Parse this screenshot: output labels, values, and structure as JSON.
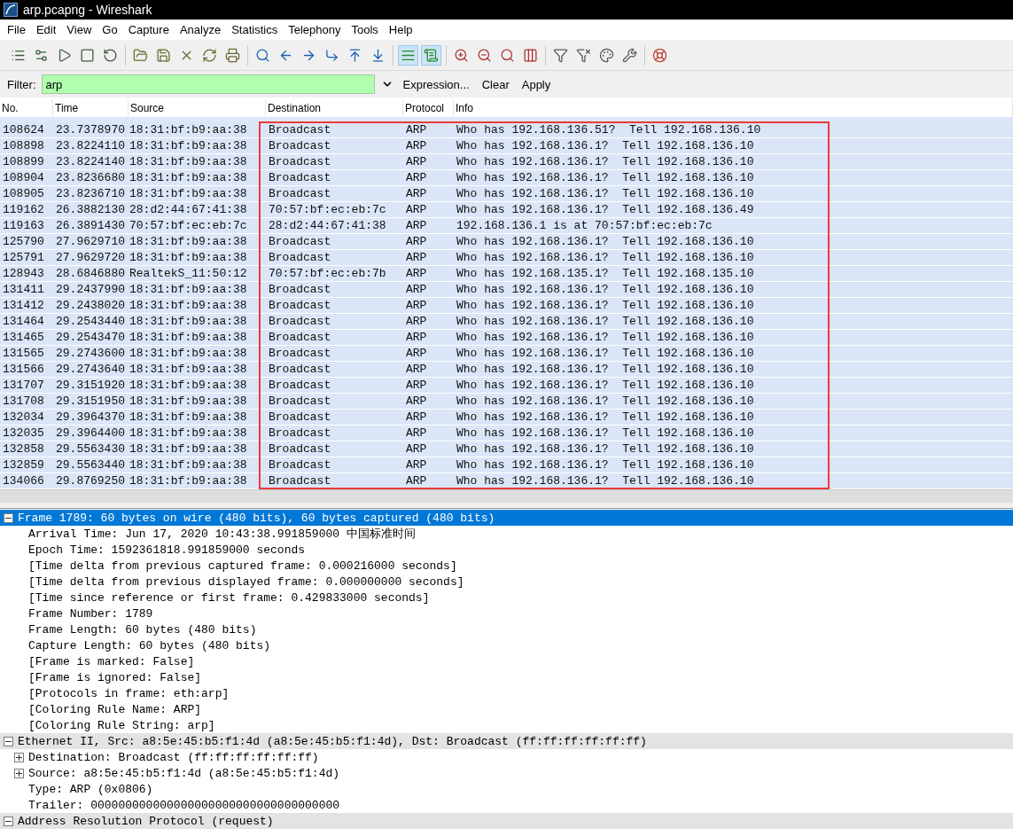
{
  "window": {
    "title": "arp.pcapng - Wireshark"
  },
  "menu": [
    "File",
    "Edit",
    "View",
    "Go",
    "Capture",
    "Analyze",
    "Statistics",
    "Telephony",
    "Tools",
    "Help"
  ],
  "toolbar": [
    [
      {
        "pressed": false
      },
      {
        "pressed": false
      },
      {
        "pressed": false
      },
      {
        "pressed": false
      },
      {
        "pressed": false
      }
    ],
    [
      {
        "pressed": false
      },
      {
        "pressed": false
      },
      {
        "pressed": false
      },
      {
        "pressed": false
      },
      {
        "pressed": false
      }
    ],
    [
      {
        "pressed": false
      },
      {
        "pressed": false
      },
      {
        "pressed": false
      },
      {
        "pressed": false
      },
      {
        "pressed": false
      },
      {
        "pressed": false
      }
    ],
    [
      {
        "pressed": true
      },
      {
        "pressed": true
      }
    ],
    [
      {
        "pressed": false
      },
      {
        "pressed": false
      },
      {
        "pressed": false
      },
      {
        "pressed": false
      }
    ],
    [
      {
        "pressed": false
      },
      {
        "pressed": false
      },
      {
        "pressed": false
      },
      {
        "pressed": false
      }
    ],
    [
      {
        "pressed": false
      }
    ]
  ],
  "filter": {
    "label": "Filter:",
    "value": "arp",
    "buttons": [
      "Expression...",
      "Clear",
      "Apply"
    ]
  },
  "packet_list": {
    "columns": [
      "No.",
      "Time",
      "Source",
      "Destination",
      "Protocol",
      "Info"
    ],
    "rows": [
      [
        "108624",
        "23.7378970",
        "18:31:bf:b9:aa:38",
        "Broadcast",
        "ARP",
        "Who has 192.168.136.51?  Tell 192.168.136.10"
      ],
      [
        "108898",
        "23.8224110",
        "18:31:bf:b9:aa:38",
        "Broadcast",
        "ARP",
        "Who has 192.168.136.1?  Tell 192.168.136.10"
      ],
      [
        "108899",
        "23.8224140",
        "18:31:bf:b9:aa:38",
        "Broadcast",
        "ARP",
        "Who has 192.168.136.1?  Tell 192.168.136.10"
      ],
      [
        "108904",
        "23.8236680",
        "18:31:bf:b9:aa:38",
        "Broadcast",
        "ARP",
        "Who has 192.168.136.1?  Tell 192.168.136.10"
      ],
      [
        "108905",
        "23.8236710",
        "18:31:bf:b9:aa:38",
        "Broadcast",
        "ARP",
        "Who has 192.168.136.1?  Tell 192.168.136.10"
      ],
      [
        "119162",
        "26.3882130",
        "28:d2:44:67:41:38",
        "70:57:bf:ec:eb:7c",
        "ARP",
        "Who has 192.168.136.1?  Tell 192.168.136.49"
      ],
      [
        "119163",
        "26.3891430",
        "70:57:bf:ec:eb:7c",
        "28:d2:44:67:41:38",
        "ARP",
        "192.168.136.1 is at 70:57:bf:ec:eb:7c"
      ],
      [
        "125790",
        "27.9629710",
        "18:31:bf:b9:aa:38",
        "Broadcast",
        "ARP",
        "Who has 192.168.136.1?  Tell 192.168.136.10"
      ],
      [
        "125791",
        "27.9629720",
        "18:31:bf:b9:aa:38",
        "Broadcast",
        "ARP",
        "Who has 192.168.136.1?  Tell 192.168.136.10"
      ],
      [
        "128943",
        "28.6846880",
        "RealtekS_11:50:12",
        "70:57:bf:ec:eb:7b",
        "ARP",
        "Who has 192.168.135.1?  Tell 192.168.135.10"
      ],
      [
        "131411",
        "29.2437990",
        "18:31:bf:b9:aa:38",
        "Broadcast",
        "ARP",
        "Who has 192.168.136.1?  Tell 192.168.136.10"
      ],
      [
        "131412",
        "29.2438020",
        "18:31:bf:b9:aa:38",
        "Broadcast",
        "ARP",
        "Who has 192.168.136.1?  Tell 192.168.136.10"
      ],
      [
        "131464",
        "29.2543440",
        "18:31:bf:b9:aa:38",
        "Broadcast",
        "ARP",
        "Who has 192.168.136.1?  Tell 192.168.136.10"
      ],
      [
        "131465",
        "29.2543470",
        "18:31:bf:b9:aa:38",
        "Broadcast",
        "ARP",
        "Who has 192.168.136.1?  Tell 192.168.136.10"
      ],
      [
        "131565",
        "29.2743600",
        "18:31:bf:b9:aa:38",
        "Broadcast",
        "ARP",
        "Who has 192.168.136.1?  Tell 192.168.136.10"
      ],
      [
        "131566",
        "29.2743640",
        "18:31:bf:b9:aa:38",
        "Broadcast",
        "ARP",
        "Who has 192.168.136.1?  Tell 192.168.136.10"
      ],
      [
        "131707",
        "29.3151920",
        "18:31:bf:b9:aa:38",
        "Broadcast",
        "ARP",
        "Who has 192.168.136.1?  Tell 192.168.136.10"
      ],
      [
        "131708",
        "29.3151950",
        "18:31:bf:b9:aa:38",
        "Broadcast",
        "ARP",
        "Who has 192.168.136.1?  Tell 192.168.136.10"
      ],
      [
        "132034",
        "29.3964370",
        "18:31:bf:b9:aa:38",
        "Broadcast",
        "ARP",
        "Who has 192.168.136.1?  Tell 192.168.136.10"
      ],
      [
        "132035",
        "29.3964400",
        "18:31:bf:b9:aa:38",
        "Broadcast",
        "ARP",
        "Who has 192.168.136.1?  Tell 192.168.136.10"
      ],
      [
        "132858",
        "29.5563430",
        "18:31:bf:b9:aa:38",
        "Broadcast",
        "ARP",
        "Who has 192.168.136.1?  Tell 192.168.136.10"
      ],
      [
        "132859",
        "29.5563440",
        "18:31:bf:b9:aa:38",
        "Broadcast",
        "ARP",
        "Who has 192.168.136.1?  Tell 192.168.136.10"
      ],
      [
        "134066",
        "29.8769250",
        "18:31:bf:b9:aa:38",
        "Broadcast",
        "ARP",
        "Who has 192.168.136.1?  Tell 192.168.136.10"
      ]
    ]
  },
  "details": [
    {
      "text": "Frame 1789: 60 bytes on wire (480 bits), 60 bytes captured (480 bits)",
      "expanded": true,
      "selected": true,
      "children": [
        {
          "text": "Arrival Time: Jun 17, 2020 10:43:38.991859000 中国标准时间"
        },
        {
          "text": "Epoch Time: 1592361818.991859000 seconds"
        },
        {
          "text": "[Time delta from previous captured frame: 0.000216000 seconds]"
        },
        {
          "text": "[Time delta from previous displayed frame: 0.000000000 seconds]"
        },
        {
          "text": "[Time since reference or first frame: 0.429833000 seconds]"
        },
        {
          "text": "Frame Number: 1789"
        },
        {
          "text": "Frame Length: 60 bytes (480 bits)"
        },
        {
          "text": "Capture Length: 60 bytes (480 bits)"
        },
        {
          "text": "[Frame is marked: False]"
        },
        {
          "text": "[Frame is ignored: False]"
        },
        {
          "text": "[Protocols in frame: eth:arp]"
        },
        {
          "text": "[Coloring Rule Name: ARP]"
        },
        {
          "text": "[Coloring Rule String: arp]"
        }
      ]
    },
    {
      "text": "Ethernet II, Src: a8:5e:45:b5:f1:4d (a8:5e:45:b5:f1:4d), Dst: Broadcast (ff:ff:ff:ff:ff:ff)",
      "expanded": true,
      "selected": false,
      "children": [
        {
          "text": "Destination: Broadcast (ff:ff:ff:ff:ff:ff)",
          "expanded": false,
          "selected": false
        },
        {
          "text": "Source: a8:5e:45:b5:f1:4d (a8:5e:45:b5:f1:4d)",
          "expanded": false,
          "selected": false
        },
        {
          "text": "Type: ARP (0x0806)"
        },
        {
          "text": "Trailer: 000000000000000000000000000000000000"
        }
      ]
    },
    {
      "text": "Address Resolution Protocol (request)",
      "expanded": true,
      "selected": false
    }
  ]
}
